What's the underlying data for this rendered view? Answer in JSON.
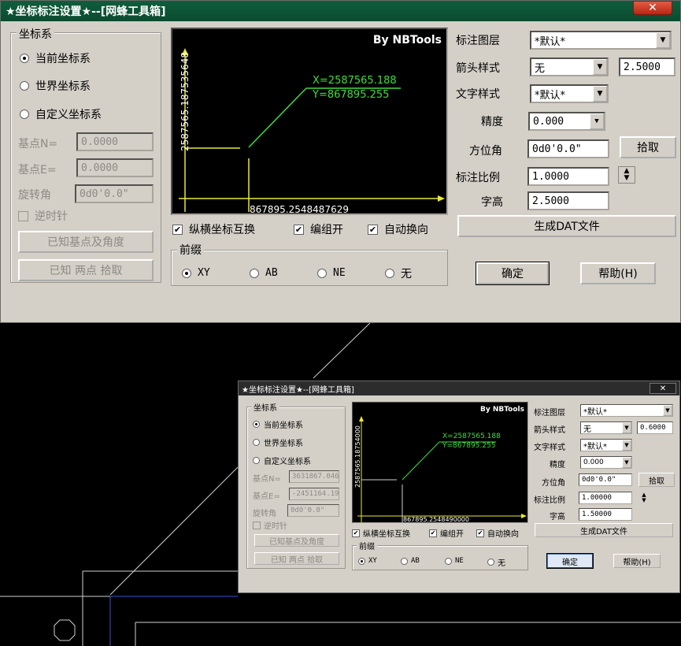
{
  "dialog_main": {
    "title": "★坐标标注设置★--[网蜂工具箱]",
    "close": "✕",
    "coord_system": {
      "title": "坐标系",
      "options": [
        "当前坐标系",
        "世界坐标系",
        "自定义坐标系"
      ],
      "selected": 0,
      "base_n_label": "基点N=",
      "base_n_value": "0.0000",
      "base_e_label": "基点E=",
      "base_e_value": "0.0000",
      "rotation_label": "旋转角",
      "rotation_value": "0d0'0.0\"",
      "counterclockwise_label": "逆时针",
      "btn_known_base": "已知基点及角度",
      "btn_two_points": "已知 两点 拾取"
    },
    "preview": {
      "brand": "By NBTools",
      "label_x": "X=2587565.188",
      "label_y": "Y=867895.255",
      "vertical_axis": "2587565.187535648",
      "horizontal_axis": "867895.2548487629"
    },
    "checks": [
      {
        "label": "纵横坐标互换",
        "checked": true
      },
      {
        "label": "编组开",
        "checked": true
      },
      {
        "label": "自动换向",
        "checked": true
      }
    ],
    "prefix": {
      "title": "前缀",
      "options": [
        "XY",
        "AB",
        "NE",
        "无"
      ],
      "selected": 0
    },
    "right": {
      "layer_label": "标注图层",
      "layer_value": "*默认*",
      "arrow_label": "箭头样式",
      "arrow_value": "无",
      "arrow_size": "2.5000",
      "text_style_label": "文字样式",
      "text_style_value": "*默认*",
      "precision_label": "精度",
      "precision_value": "0.000",
      "azimuth_label": "方位角",
      "azimuth_value": "0d0'0.0\"",
      "pick_btn": "拾取",
      "scale_label": "标注比例",
      "scale_value": "1.0000",
      "height_label": "字高",
      "height_value": "2.5000",
      "dat_btn": "生成DAT文件",
      "ok_btn": "确定",
      "help_btn": "帮助(H)"
    }
  },
  "dialog_small": {
    "title": "★坐标标注设置★--[网蜂工具箱]",
    "close": "✕",
    "coord_system": {
      "title": "坐标系",
      "options": [
        "当前坐标系",
        "世界坐标系",
        "自定义坐标系"
      ],
      "selected": 0,
      "base_n_label": "基点N=",
      "base_n_value": "3631867.0469",
      "base_e_label": "基点E=",
      "base_e_value": "-2451164.190",
      "rotation_label": "旋转角",
      "rotation_value": "0d0'0.0\"",
      "counterclockwise_label": "逆时针",
      "btn_known_base": "已知基点及角度",
      "btn_two_points": "已知 两点 拾取"
    },
    "preview": {
      "brand": "By NBTools",
      "label_x": "X=2587565.188",
      "label_y": "Y=867895.255",
      "vertical_axis": "2587565.18754000",
      "horizontal_axis": "867895.2548490000"
    },
    "checks": [
      {
        "label": "纵横坐标互换",
        "checked": true
      },
      {
        "label": "编组开",
        "checked": true
      },
      {
        "label": "自动换向",
        "checked": true
      }
    ],
    "prefix": {
      "title": "前缀",
      "options": [
        "XY",
        "AB",
        "NE",
        "无"
      ],
      "selected": 0
    },
    "right": {
      "layer_label": "标注图层",
      "layer_value": "*默认*",
      "arrow_label": "箭头样式",
      "arrow_value": "无",
      "arrow_size": "0.6000",
      "text_style_label": "文字样式",
      "text_style_value": "*默认*",
      "precision_label": "精度",
      "precision_value": "0.000",
      "azimuth_label": "方位角",
      "azimuth_value": "0d0'0.0\"",
      "pick_btn": "拾取",
      "scale_label": "标注比例",
      "scale_value": "1.00000",
      "height_label": "字高",
      "height_value": "1.50000",
      "dat_btn": "生成DAT文件",
      "ok_btn": "确定",
      "help_btn": "帮助(H)"
    }
  },
  "colors": {
    "title_green": "#0b4b30",
    "dialog_face": "#d4d0c8",
    "preview_green": "#3dde3d",
    "preview_yellow": "#e8e83a",
    "cad_background": "#000000"
  }
}
